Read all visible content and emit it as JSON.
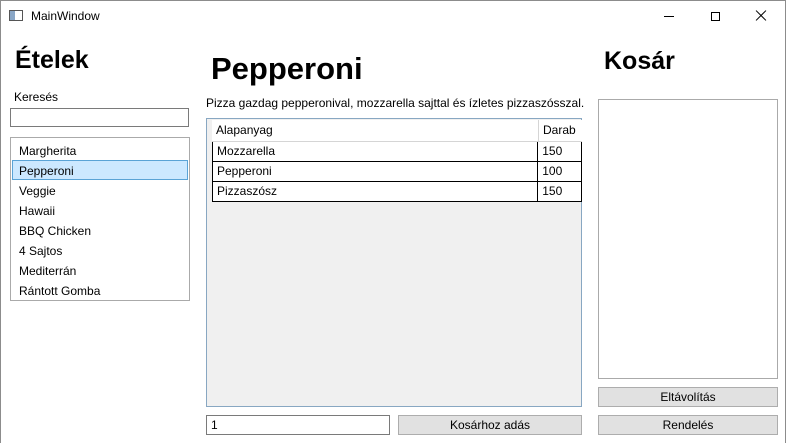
{
  "window": {
    "title": "MainWindow"
  },
  "left": {
    "heading": "Ételek",
    "search_label": "Keresés",
    "search_value": "",
    "items": [
      {
        "label": "Margherita"
      },
      {
        "label": "Pepperoni"
      },
      {
        "label": "Veggie"
      },
      {
        "label": "Hawaii"
      },
      {
        "label": "BBQ Chicken"
      },
      {
        "label": "4 Sajtos"
      },
      {
        "label": "Mediterrán"
      },
      {
        "label": "Rántott Gomba"
      }
    ],
    "selected_index": 1
  },
  "detail": {
    "title": "Pepperoni",
    "description": "Pizza gazdag pepperonival, mozzarella sajttal és ízletes pizzaszósszal.",
    "columns": {
      "ingredient": "Alapanyag",
      "count": "Darab"
    },
    "rows": [
      {
        "ingredient": "Mozzarella",
        "count": "150"
      },
      {
        "ingredient": "Pepperoni",
        "count": "100"
      },
      {
        "ingredient": "Pizzaszósz",
        "count": "150"
      }
    ],
    "quantity_value": "1",
    "add_label": "Kosárhoz adás"
  },
  "cart": {
    "heading": "Kosár",
    "items": [],
    "remove_label": "Eltávolítás",
    "order_label": "Rendelés"
  },
  "colors": {
    "selection_bg": "#cce8ff",
    "selection_border": "#5aa3d6",
    "button_bg": "#e1e1e1",
    "grid_bg": "#f0f0f0"
  }
}
